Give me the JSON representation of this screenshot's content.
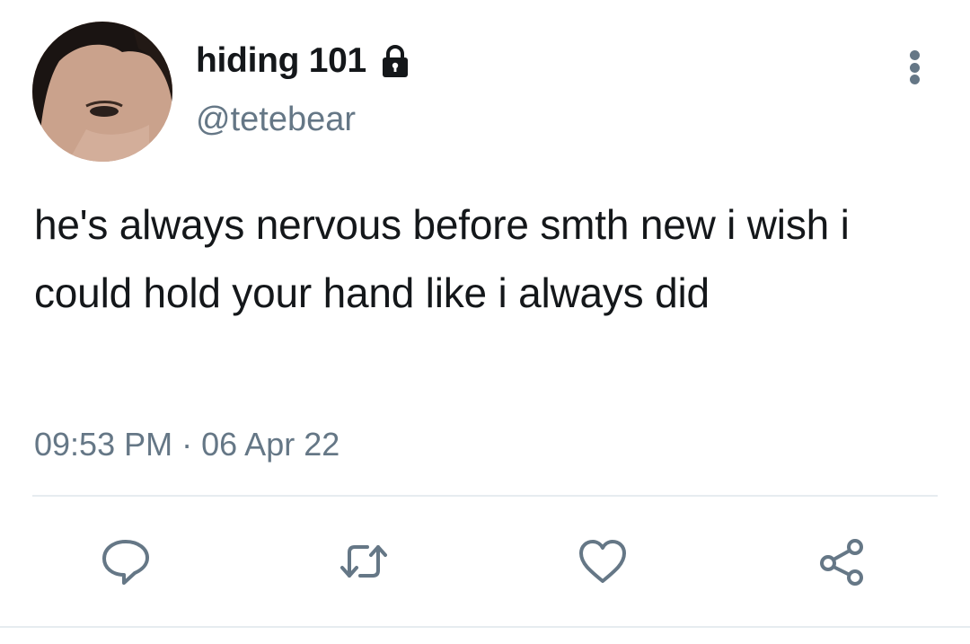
{
  "tweet": {
    "author": {
      "display_name": "hiding 101",
      "handle": "@tetebear",
      "protected": true,
      "avatar_icon": "profile-photo"
    },
    "text": "he's always nervous before smth new i wish i could hold your hand like i always did",
    "time": "09:53 PM",
    "separator": "·",
    "date": "06 Apr 22"
  },
  "actions": [
    {
      "name": "reply",
      "icon": "speech-bubble-icon"
    },
    {
      "name": "retweet",
      "icon": "retweet-arrows-icon"
    },
    {
      "name": "like",
      "icon": "heart-icon"
    },
    {
      "name": "share",
      "icon": "share-nodes-icon"
    }
  ],
  "colors": {
    "text_primary": "#14171a",
    "text_secondary": "#657786",
    "divider": "#e6ecf0",
    "background": "#ffffff"
  }
}
